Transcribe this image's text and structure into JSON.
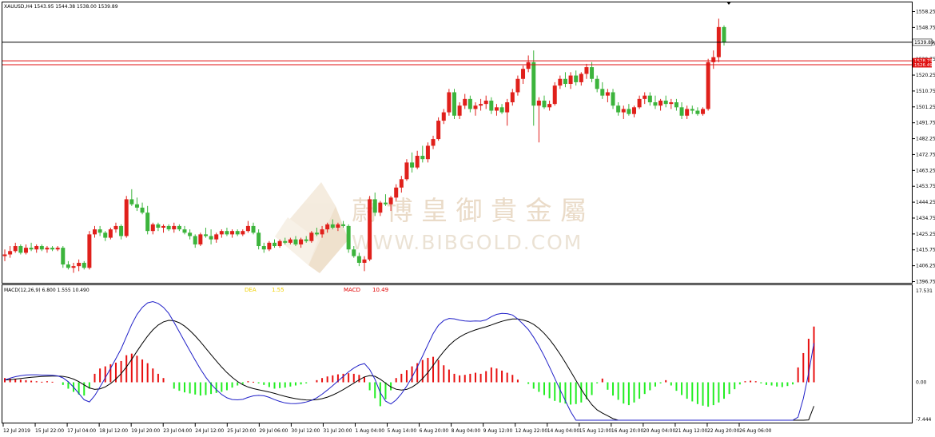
{
  "window": {
    "symbol_line": "XAUUSD,H4   1543.95   1544.38   1538.00   1539.89"
  },
  "watermark": {
    "chinese": "蔚 博 皇 御 貴 金 屬",
    "latin": "WWW.BIBGOLD.COM"
  },
  "price_panel": {
    "y_ticks": [
      "1558.25",
      "1548.75",
      "1539.25",
      "1529.75",
      "1520.25",
      "1510.75",
      "1501.25",
      "1491.75",
      "1482.25",
      "1472.75",
      "1463.25",
      "1453.75",
      "1444.25",
      "1434.75",
      "1425.25",
      "1415.75",
      "1406.25",
      "1396.75"
    ],
    "current_price_label": "1539.89",
    "red_labels": [
      "1528.79",
      "1526.49"
    ]
  },
  "macd_panel": {
    "title": "MACD(12,26,9) 6.800 1.555 10.490",
    "dea_label": "DEA",
    "dea_value": "1.55",
    "macd_label": "MACD",
    "macd_value": "10.49",
    "y_ticks": [
      "17.531",
      "0.00",
      "-7.444"
    ]
  },
  "x_axis_labels": [
    "12 Jul 2019",
    "15 Jul 22:00",
    "17 Jul 04:00",
    "18 Jul 12:00",
    "19 Jul 20:00",
    "23 Jul 04:00",
    "24 Jul 12:00",
    "25 Jul 20:00",
    "29 Jul 06:00",
    "30 Jul 12:00",
    "31 Jul 20:00",
    "1 Aug 04:00",
    "5 Aug 14:00",
    "6 Aug 20:00",
    "8 Aug 04:00",
    "9 Aug 12:00",
    "12 Aug 22:00",
    "14 Aug 04:00",
    "15 Aug 12:00",
    "16 Aug 20:00",
    "20 Aug 04:00",
    "21 Aug 12:00",
    "22 Aug 20:00",
    "26 Aug 06:00"
  ],
  "colors": {
    "bull": "#e0201b",
    "bear": "#3cb43c",
    "macd_pos": "#e81010",
    "macd_neg": "#22ee22",
    "signal_line": "#000000",
    "macd_line": "#2020c8",
    "level_red": "#e01010",
    "level_black": "#000000",
    "dea_color": "#f0d000",
    "macd_label_color": "#e00000",
    "watermark": "#e8cfb0"
  },
  "chart_data": {
    "type": "candlestick",
    "symbol": "XAUUSD",
    "timeframe": "H4",
    "price_axis_range": [
      1396.75,
      1558.25
    ],
    "macd_axis_range": [
      -7.444,
      17.531
    ],
    "horizontal_levels": [
      1539.89,
      1528.79,
      1526.49
    ],
    "candles": [
      [
        1412,
        1416,
        1409,
        1413
      ],
      [
        1413,
        1418,
        1411,
        1415
      ],
      [
        1415,
        1420,
        1414,
        1418
      ],
      [
        1418,
        1419,
        1413,
        1414
      ],
      [
        1414,
        1419,
        1413,
        1417
      ],
      [
        1417,
        1420,
        1415,
        1416
      ],
      [
        1416,
        1419,
        1414,
        1418
      ],
      [
        1418,
        1419,
        1415,
        1416
      ],
      [
        1416,
        1418,
        1414,
        1417
      ],
      [
        1417,
        1418,
        1415,
        1416
      ],
      [
        1416,
        1418,
        1415,
        1417
      ],
      [
        1417,
        1418,
        1405,
        1407
      ],
      [
        1407,
        1409,
        1404,
        1405
      ],
      [
        1405,
        1408,
        1402,
        1406
      ],
      [
        1406,
        1410,
        1403,
        1408
      ],
      [
        1408,
        1409,
        1404,
        1405
      ],
      [
        1405,
        1427,
        1404,
        1425
      ],
      [
        1425,
        1430,
        1423,
        1428
      ],
      [
        1428,
        1430,
        1424,
        1426
      ],
      [
        1426,
        1427,
        1421,
        1423
      ],
      [
        1423,
        1429,
        1422,
        1428
      ],
      [
        1428,
        1432,
        1426,
        1430
      ],
      [
        1430,
        1431,
        1422,
        1424
      ],
      [
        1424,
        1448,
        1423,
        1446
      ],
      [
        1446,
        1452,
        1442,
        1443
      ],
      [
        1443,
        1447,
        1439,
        1441
      ],
      [
        1441,
        1444,
        1437,
        1438
      ],
      [
        1438,
        1442,
        1425,
        1427
      ],
      [
        1427,
        1432,
        1425,
        1431
      ],
      [
        1431,
        1432,
        1427,
        1429
      ],
      [
        1429,
        1431,
        1426,
        1430
      ],
      [
        1430,
        1431,
        1427,
        1428
      ],
      [
        1428,
        1432,
        1426,
        1430
      ],
      [
        1430,
        1431,
        1427,
        1428
      ],
      [
        1428,
        1430,
        1425,
        1426
      ],
      [
        1426,
        1428,
        1422,
        1424
      ],
      [
        1424,
        1425,
        1417,
        1419
      ],
      [
        1419,
        1426,
        1418,
        1425
      ],
      [
        1425,
        1429,
        1423,
        1424
      ],
      [
        1424,
        1428,
        1419,
        1422
      ],
      [
        1422,
        1426,
        1420,
        1425
      ],
      [
        1425,
        1428,
        1423,
        1427
      ],
      [
        1427,
        1429,
        1424,
        1425
      ],
      [
        1425,
        1428,
        1423,
        1427
      ],
      [
        1427,
        1428,
        1424,
        1425
      ],
      [
        1425,
        1428,
        1424,
        1427
      ],
      [
        1427,
        1433,
        1426,
        1430
      ],
      [
        1430,
        1432,
        1425,
        1426
      ],
      [
        1426,
        1428,
        1416,
        1418
      ],
      [
        1418,
        1420,
        1414,
        1416
      ],
      [
        1416,
        1421,
        1415,
        1420
      ],
      [
        1420,
        1422,
        1417,
        1418
      ],
      [
        1418,
        1422,
        1417,
        1421
      ],
      [
        1421,
        1423,
        1419,
        1420
      ],
      [
        1420,
        1423,
        1419,
        1422
      ],
      [
        1422,
        1424,
        1418,
        1419
      ],
      [
        1419,
        1423,
        1417,
        1422
      ],
      [
        1422,
        1424,
        1420,
        1421
      ],
      [
        1421,
        1427,
        1420,
        1426
      ],
      [
        1426,
        1429,
        1424,
        1425
      ],
      [
        1425,
        1430,
        1423,
        1428
      ],
      [
        1428,
        1432,
        1426,
        1431
      ],
      [
        1431,
        1434,
        1428,
        1429
      ],
      [
        1429,
        1432,
        1427,
        1431
      ],
      [
        1431,
        1433,
        1429,
        1430
      ],
      [
        1430,
        1431,
        1414,
        1416
      ],
      [
        1416,
        1418,
        1411,
        1412
      ],
      [
        1412,
        1414,
        1406,
        1408
      ],
      [
        1408,
        1412,
        1403,
        1410
      ],
      [
        1410,
        1448,
        1409,
        1446
      ],
      [
        1446,
        1450,
        1436,
        1438
      ],
      [
        1438,
        1445,
        1436,
        1444
      ],
      [
        1444,
        1449,
        1442,
        1443
      ],
      [
        1443,
        1448,
        1439,
        1447
      ],
      [
        1447,
        1455,
        1445,
        1453
      ],
      [
        1453,
        1460,
        1450,
        1458
      ],
      [
        1458,
        1470,
        1457,
        1468
      ],
      [
        1468,
        1474,
        1462,
        1465
      ],
      [
        1465,
        1475,
        1464,
        1472
      ],
      [
        1472,
        1478,
        1468,
        1470
      ],
      [
        1470,
        1480,
        1468,
        1478
      ],
      [
        1478,
        1484,
        1476,
        1482
      ],
      [
        1482,
        1495,
        1481,
        1493
      ],
      [
        1493,
        1500,
        1491,
        1498
      ],
      [
        1498,
        1512,
        1496,
        1510
      ],
      [
        1510,
        1512,
        1494,
        1496
      ],
      [
        1496,
        1504,
        1494,
        1502
      ],
      [
        1502,
        1509,
        1500,
        1506
      ],
      [
        1506,
        1508,
        1498,
        1500
      ],
      [
        1500,
        1504,
        1496,
        1502
      ],
      [
        1502,
        1506,
        1499,
        1503
      ],
      [
        1503,
        1508,
        1500,
        1505
      ],
      [
        1505,
        1507,
        1497,
        1499
      ],
      [
        1499,
        1503,
        1496,
        1501
      ],
      [
        1501,
        1503,
        1497,
        1498
      ],
      [
        1498,
        1506,
        1490,
        1504
      ],
      [
        1504,
        1512,
        1502,
        1510
      ],
      [
        1510,
        1520,
        1508,
        1518
      ],
      [
        1518,
        1526,
        1515,
        1524
      ],
      [
        1524,
        1532,
        1522,
        1528
      ],
      [
        1528,
        1535,
        1490,
        1502
      ],
      [
        1502,
        1507,
        1480,
        1505
      ],
      [
        1505,
        1508,
        1500,
        1501
      ],
      [
        1501,
        1505,
        1499,
        1503
      ],
      [
        1503,
        1516,
        1502,
        1514
      ],
      [
        1514,
        1520,
        1512,
        1518
      ],
      [
        1518,
        1522,
        1513,
        1515
      ],
      [
        1515,
        1522,
        1512,
        1520
      ],
      [
        1520,
        1523,
        1514,
        1516
      ],
      [
        1516,
        1522,
        1514,
        1521
      ],
      [
        1521,
        1527,
        1518,
        1525
      ],
      [
        1525,
        1528,
        1516,
        1518
      ],
      [
        1518,
        1520,
        1510,
        1512
      ],
      [
        1512,
        1516,
        1506,
        1508
      ],
      [
        1508,
        1512,
        1504,
        1510
      ],
      [
        1510,
        1512,
        1500,
        1502
      ],
      [
        1502,
        1504,
        1496,
        1498
      ],
      [
        1498,
        1502,
        1494,
        1500
      ],
      [
        1500,
        1503,
        1496,
        1497
      ],
      [
        1497,
        1502,
        1495,
        1501
      ],
      [
        1501,
        1508,
        1500,
        1506
      ],
      [
        1506,
        1510,
        1503,
        1508
      ],
      [
        1508,
        1510,
        1502,
        1504
      ],
      [
        1504,
        1508,
        1500,
        1502
      ],
      [
        1502,
        1506,
        1499,
        1505
      ],
      [
        1505,
        1508,
        1501,
        1503
      ],
      [
        1503,
        1506,
        1500,
        1504
      ],
      [
        1504,
        1506,
        1499,
        1501
      ],
      [
        1501,
        1504,
        1494,
        1496
      ],
      [
        1496,
        1502,
        1494,
        1500
      ],
      [
        1500,
        1502,
        1497,
        1499
      ],
      [
        1499,
        1501,
        1496,
        1497
      ],
      [
        1497,
        1501,
        1496,
        1500
      ],
      [
        1500,
        1530,
        1499,
        1528
      ],
      [
        1528,
        1535,
        1524,
        1531
      ],
      [
        1531,
        1554,
        1528,
        1549
      ],
      [
        1549,
        1550,
        1538,
        1540
      ]
    ],
    "macd_histogram": [
      0.8,
      0.7,
      0.6,
      0.5,
      0.4,
      0.3,
      0.2,
      0.1,
      0.2,
      0.1,
      0,
      -0.5,
      -1.2,
      -1.8,
      -2.3,
      -2.5,
      -1.2,
      1.6,
      2.6,
      3.0,
      3.4,
      3.7,
      4.0,
      5.1,
      5.4,
      5.0,
      4.3,
      3.6,
      2.6,
      1.6,
      0.8,
      0,
      -1.2,
      -1.6,
      -1.9,
      -2.1,
      -2.3,
      -2.5,
      -2.4,
      -2.2,
      -2.0,
      -1.8,
      -1.5,
      -1.0,
      -0.6,
      -0.3,
      0.2,
      0.1,
      -0.2,
      -0.5,
      -0.9,
      -1.2,
      -1.1,
      -1.0,
      -0.8,
      -0.6,
      -0.4,
      -0.2,
      0,
      0.4,
      0.8,
      1.1,
      1.3,
      1.5,
      1.6,
      1.7,
      1.6,
      1.4,
      1.0,
      -1.5,
      -3.0,
      -4.5,
      -3.2,
      -1.5,
      0.8,
      1.6,
      2.3,
      3.0,
      3.6,
      4.2,
      4.6,
      4.8,
      4.2,
      3.2,
      2.4,
      1.6,
      1.3,
      1.4,
      1.6,
      1.8,
      1.6,
      2.1,
      2.8,
      2.6,
      2.2,
      1.8,
      1.4,
      0.5,
      0,
      -0.3,
      -1.2,
      -1.8,
      -2.4,
      -3.0,
      -3.5,
      -3.8,
      -4.0,
      -4.2,
      -4.1,
      -3.8,
      -3.2,
      -2.4,
      -0.2,
      0.7,
      -1.4,
      -2.5,
      -3.3,
      -4.0,
      -4.3,
      -3.8,
      -3.1,
      -2.2,
      -1.5,
      -0.8,
      -0.2,
      0.4,
      -0.6,
      -1.6,
      -2.4,
      -3.1,
      -3.6,
      -4.1,
      -4.4,
      -4.6,
      -4.3,
      -3.8,
      -3.1,
      -2.2,
      -1.3,
      -0.4,
      0.2,
      0.3,
      0.2,
      -0.2,
      -0.5,
      -0.6,
      -0.8,
      -0.9,
      -0.7,
      -0.4,
      2.8,
      5.5,
      8.2,
      10.5
    ]
  }
}
